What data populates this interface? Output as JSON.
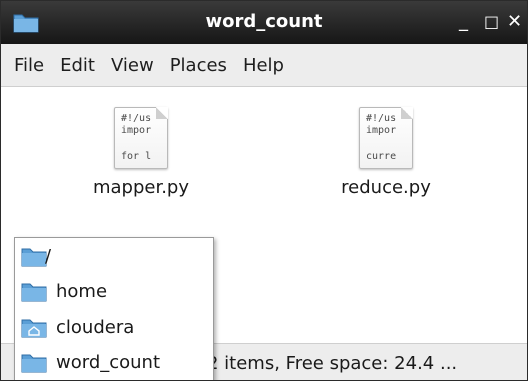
{
  "window": {
    "title": "word_count",
    "minimize_glyph": "_",
    "maximize_glyph": "□",
    "close_glyph": "✕"
  },
  "menubar": {
    "items": [
      "File",
      "Edit",
      "View",
      "Places",
      "Help"
    ]
  },
  "files": [
    {
      "name": "mapper.py",
      "preview": [
        "#!/us",
        "impor",
        "",
        "for l"
      ],
      "icon": "text-file-icon"
    },
    {
      "name": "reduce.py",
      "preview": [
        "#!/us",
        "impor",
        "",
        "curre"
      ],
      "icon": "text-file-icon"
    }
  ],
  "statusbar": {
    "text": "2 items, Free space: 24.4 ..."
  },
  "path_popup": {
    "items": [
      {
        "label": "/",
        "icon": "folder-icon"
      },
      {
        "label": "home",
        "icon": "folder-icon"
      },
      {
        "label": "cloudera",
        "icon": "home-folder-icon"
      },
      {
        "label": "word_count",
        "icon": "folder-icon"
      }
    ]
  },
  "colors": {
    "titlebar": "#222222",
    "folder": "#5b9fd6",
    "menubar": "#ededed"
  }
}
